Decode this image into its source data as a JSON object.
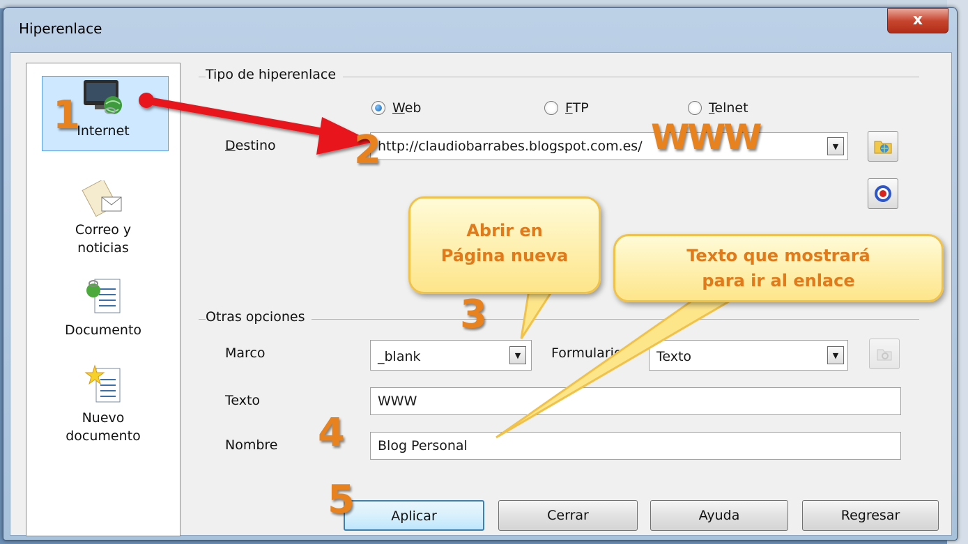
{
  "window": {
    "title": "Hiperenlace",
    "close_label": "x"
  },
  "sidebar": {
    "items": [
      {
        "label": "Internet",
        "icon": "internet-icon",
        "selected": true
      },
      {
        "label_line1": "Correo y",
        "label_line2": "noticias",
        "icon": "mail-icon"
      },
      {
        "label": "Documento",
        "icon": "document-icon"
      },
      {
        "label_line1": "Nuevo",
        "label_line2": "documento",
        "icon": "new-document-icon"
      }
    ]
  },
  "hyperlink_type": {
    "group_title": "Tipo de hiperenlace",
    "options": [
      {
        "label": "Web",
        "mnemonic": "W",
        "rest": "eb",
        "checked": true
      },
      {
        "label": "FTP",
        "mnemonic": "F",
        "rest": "TP",
        "checked": false
      },
      {
        "label": "Telnet",
        "mnemonic": "T",
        "rest": "elnet",
        "checked": false
      }
    ],
    "destino_label": "Destino",
    "destino_mnemonic": "D",
    "destino_rest": "estino",
    "destino_value": "http://claudiobarrabes.blogspot.com.es/"
  },
  "other_options": {
    "group_title": "Otras opciones",
    "marco_label": "Marco",
    "marco_value": "_blank",
    "formulario_label": "Formulario",
    "formulario_value": "Texto",
    "texto_label": "Texto",
    "texto_value": "WWW",
    "nombre_label": "Nombre",
    "nombre_value": "Blog Personal"
  },
  "buttons": {
    "apply": "Aplicar",
    "close": "Cerrar",
    "help": "Ayuda",
    "back": "Regresar"
  },
  "annotations": {
    "step1": "1",
    "step2": "2",
    "step3": "3",
    "step4": "4",
    "step5": "5",
    "www_overlay": "WWW",
    "callout_new_page_line1": "Abrir en",
    "callout_new_page_line2": "Página nueva",
    "callout_text_line1": "Texto que mostrará",
    "callout_text_line2": "para ir al enlace"
  },
  "colors": {
    "annotation_orange": "#e8821e",
    "callout_fill": "#fde58a",
    "arrow_red": "#e8141e",
    "selection_blue": "#cde8ff"
  }
}
